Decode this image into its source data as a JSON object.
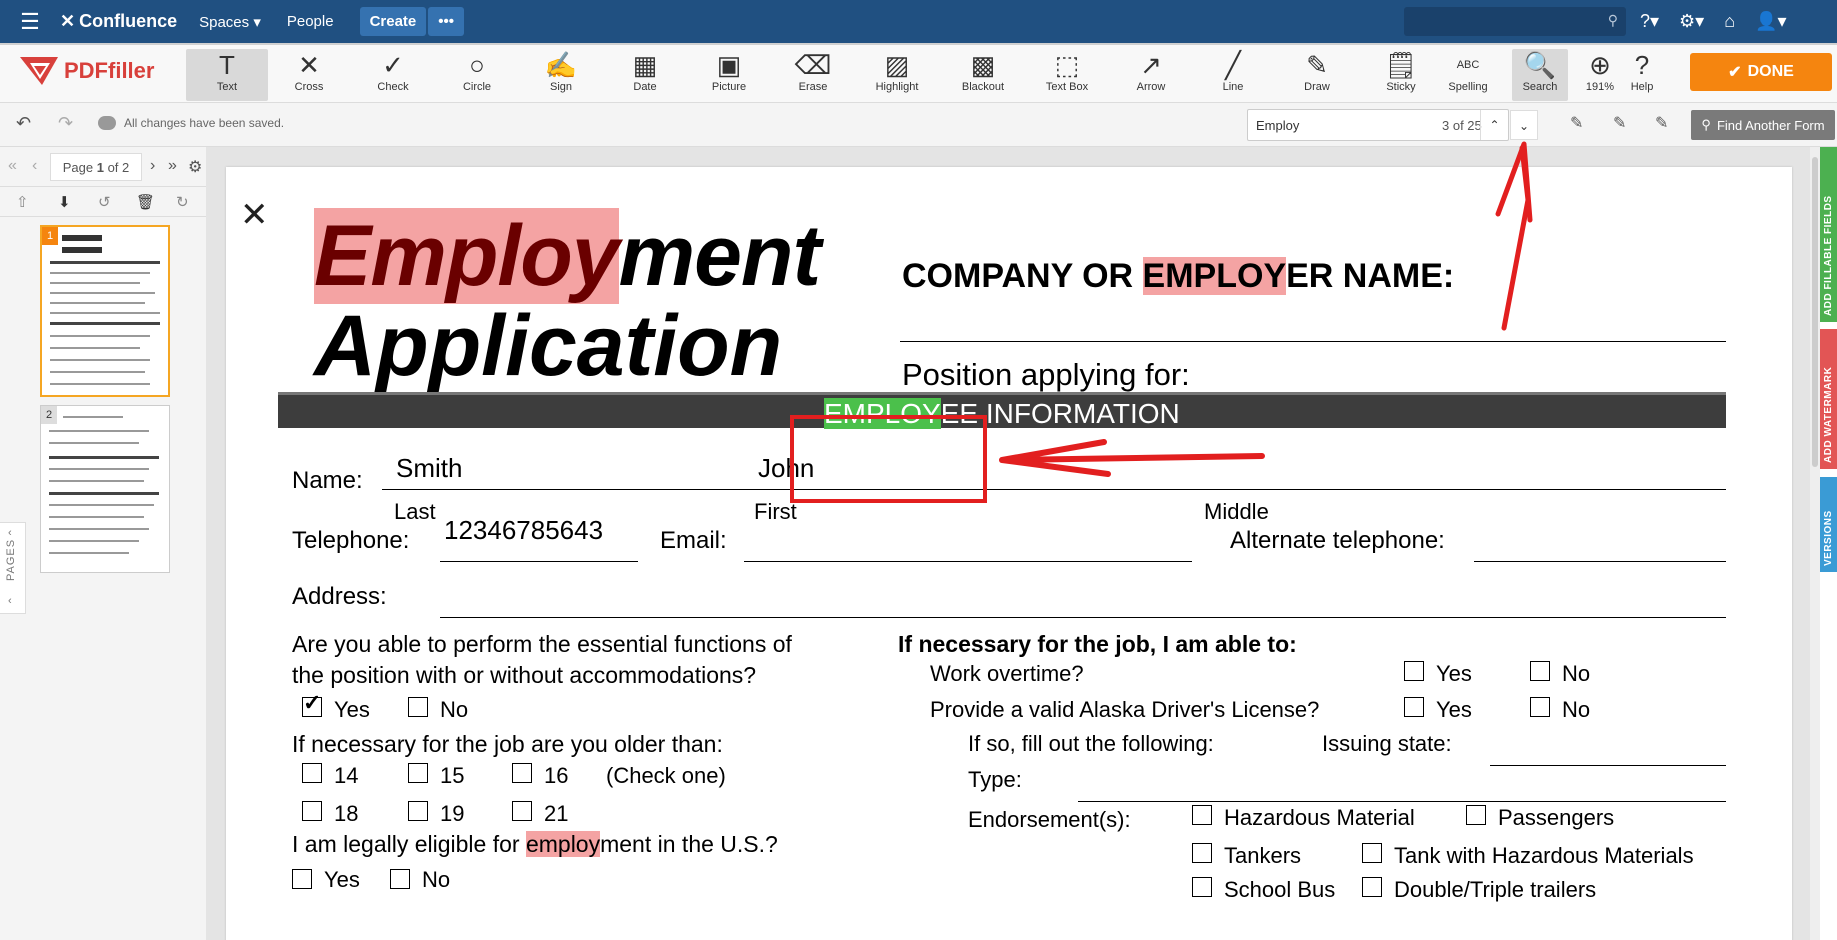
{
  "confluence": {
    "app_name": "Confluence",
    "nav": [
      "Spaces",
      "People"
    ],
    "create_label": "Create",
    "more_label": "•••"
  },
  "pdffiller": {
    "brand": "PDFfiller",
    "tools": [
      {
        "label": "Text",
        "icon": "T"
      },
      {
        "label": "Cross",
        "icon": "✕"
      },
      {
        "label": "Check",
        "icon": "✓"
      },
      {
        "label": "Circle",
        "icon": "○"
      },
      {
        "label": "Sign",
        "icon": "✍"
      },
      {
        "label": "Date",
        "icon": "▦"
      },
      {
        "label": "Picture",
        "icon": "▣"
      },
      {
        "label": "Erase",
        "icon": "⌫"
      },
      {
        "label": "Highlight",
        "icon": "▨"
      },
      {
        "label": "Blackout",
        "icon": "▩"
      },
      {
        "label": "Text Box",
        "icon": "⬚"
      },
      {
        "label": "Arrow",
        "icon": "↗"
      },
      {
        "label": "Line",
        "icon": "╱"
      },
      {
        "label": "Draw",
        "icon": "✎"
      },
      {
        "label": "Sticky",
        "icon": "🗒"
      },
      {
        "label": "Spelling",
        "icon": "ABC"
      },
      {
        "label": "Search",
        "icon": "🔍"
      },
      {
        "label": "191%",
        "icon": "⊕"
      },
      {
        "label": "Help",
        "icon": "?"
      }
    ],
    "done_label": "DONE",
    "saved_status": "All changes have been saved.",
    "find": {
      "query": "Employ",
      "count": "3 of 25"
    },
    "find_form_label": "Find Another Form",
    "page_indicator": {
      "prefix": "Page",
      "current": "1",
      "suffix": "of 2"
    },
    "pages_tab": "PAGES",
    "side_tabs": [
      "ADD FILLABLE FIELDS",
      "ADD WATERMARK",
      "VERSIONS"
    ],
    "thumb_numbers": [
      "1",
      "2"
    ]
  },
  "document": {
    "title_highlight": "Employ",
    "title_rest": "ment",
    "title_line2": "Application",
    "company_pre": "COMPANY OR ",
    "company_hl": "EMPLOY",
    "company_post": "ER NAME:",
    "position_label": "Position applying for:",
    "section_hl": "EMPLOY",
    "section_rest": "EE INFORMATION",
    "name_label": "Name:",
    "last_value": "Smith",
    "first_value": "John",
    "last_label": "Last",
    "first_label": "First",
    "middle_label": "Middle",
    "telephone_label": "Telephone:",
    "telephone_value": "12346785643",
    "email_label": "Email:",
    "alt_phone_label": "Alternate telephone:",
    "address_label": "Address:",
    "q1_line1": "Are you able to perform the essential functions of",
    "q1_line2": "the position with or without accommodations?",
    "yes": "Yes",
    "no": "No",
    "q2": "If necessary for the job are you older than:",
    "ages_row1": [
      "14",
      "15",
      "16"
    ],
    "ages_row2": [
      "18",
      "19",
      "21"
    ],
    "check_one": "(Check one)",
    "q3_pre": "I am legally eligible for ",
    "q3_hl": "employ",
    "q3_post": "ment in the U.S.?",
    "r_heading": "If necessary for the job, I am able to:",
    "r_overtime": "Work overtime?",
    "r_license": "Provide a valid Alaska Driver's License?",
    "r_ifso": "If so, fill out the following:",
    "r_state": "Issuing state:",
    "r_type": "Type:",
    "r_endorse": "Endorsement(s):",
    "endorsements": [
      "Hazardous Material",
      "Passengers",
      "Tankers",
      "Tank with Hazardous Materials",
      "School Bus",
      "Double/Triple trailers"
    ]
  },
  "colors": {
    "confluence_blue": "#205081",
    "done_orange": "#f5850f",
    "highlight_pink": "#f4a3a3",
    "highlight_green": "#4bc04b",
    "annotation_red": "#e21f1f"
  }
}
